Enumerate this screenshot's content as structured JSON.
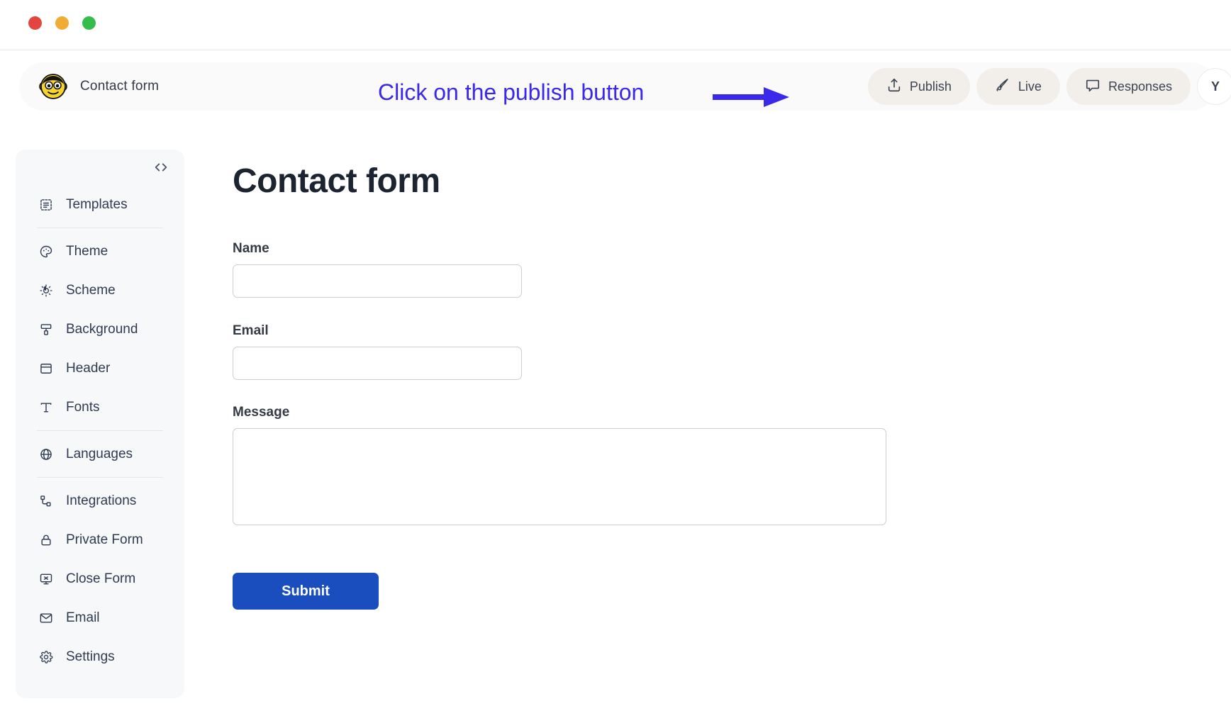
{
  "window": {
    "traffic_lights": [
      {
        "name": "close",
        "color": "#e2463f"
      },
      {
        "name": "minimize",
        "color": "#f0ad36"
      },
      {
        "name": "zoom",
        "color": "#35bd4b"
      }
    ]
  },
  "appbar": {
    "logo_icon": "monkey-face-icon",
    "title": "Contact form",
    "actions": [
      {
        "label": "Publish",
        "icon": "upload-icon"
      },
      {
        "label": "Live",
        "icon": "rocket-icon"
      },
      {
        "label": "Responses",
        "icon": "chat-bubble-icon"
      }
    ],
    "avatar_initial": "Y"
  },
  "annotation": {
    "text": "Click on the publish button",
    "color": "#3a29ea",
    "arrow_icon": "right-arrow-icon"
  },
  "sidebar": {
    "collapse_icon": "code-brackets-icon",
    "groups": [
      {
        "items": [
          {
            "label": "Templates",
            "icon": "templates-icon"
          }
        ]
      },
      {
        "items": [
          {
            "label": "Theme",
            "icon": "palette-icon"
          },
          {
            "label": "Scheme",
            "icon": "sun-contrast-icon"
          },
          {
            "label": "Background",
            "icon": "paint-roller-icon"
          },
          {
            "label": "Header",
            "icon": "layout-header-icon"
          },
          {
            "label": "Fonts",
            "icon": "text-type-icon"
          }
        ]
      },
      {
        "items": [
          {
            "label": "Languages",
            "icon": "globe-icon"
          }
        ]
      },
      {
        "items": [
          {
            "label": "Integrations",
            "icon": "plug-nodes-icon"
          },
          {
            "label": "Private Form",
            "icon": "lock-icon"
          },
          {
            "label": "Close Form",
            "icon": "monitor-x-icon"
          },
          {
            "label": "Email",
            "icon": "envelope-icon"
          },
          {
            "label": "Settings",
            "icon": "gear-icon"
          }
        ]
      }
    ]
  },
  "form": {
    "title": "Contact form",
    "fields": [
      {
        "label": "Name",
        "type": "text",
        "value": "",
        "placeholder": ""
      },
      {
        "label": "Email",
        "type": "text",
        "value": "",
        "placeholder": ""
      },
      {
        "label": "Message",
        "type": "textarea",
        "value": "",
        "placeholder": ""
      }
    ],
    "submit_label": "Submit",
    "submit_color": "#1a4dbe"
  }
}
